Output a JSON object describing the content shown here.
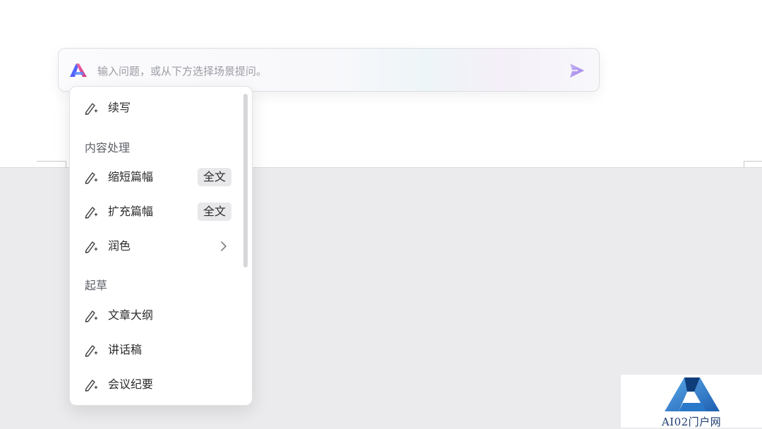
{
  "assistant_bar": {
    "logo_icon": "assistant-logo-icon",
    "input_placeholder": "输入问题，或从下方选择场景提问。",
    "send_icon": "send-arrow-icon"
  },
  "menu": {
    "items": [
      {
        "label": "续写",
        "icon": "pen-sparkle-icon"
      }
    ],
    "sections": [
      {
        "title": "内容处理",
        "items": [
          {
            "label": "缩短篇幅",
            "badge": "全文",
            "icon": "pen-sparkle-icon"
          },
          {
            "label": "扩充篇幅",
            "badge": "全文",
            "icon": "pen-sparkle-icon"
          },
          {
            "label": "润色",
            "submenu": true,
            "icon": "pen-sparkle-icon"
          }
        ]
      },
      {
        "title": "起草",
        "items": [
          {
            "label": "文章大纲",
            "icon": "pen-sparkle-icon"
          },
          {
            "label": "讲话稿",
            "icon": "pen-sparkle-icon"
          },
          {
            "label": "会议纪要",
            "icon": "pen-sparkle-icon"
          }
        ]
      }
    ]
  },
  "watermark": {
    "text": "AI02门户网"
  },
  "colors": {
    "accent_purple": "#a98ee8",
    "logo_blue": "#2f6df6",
    "logo_pink": "#e8519a"
  }
}
